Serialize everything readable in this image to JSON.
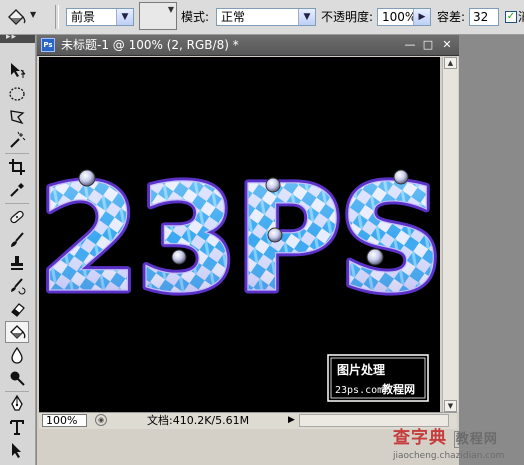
{
  "options_bar": {
    "fill_source_value": "前景",
    "mode_label": "模式:",
    "mode_value": "正常",
    "opacity_label": "不透明度:",
    "opacity_value": "100%",
    "tolerance_label": "容差:",
    "tolerance_value": "32",
    "antialias_label": "消"
  },
  "toolbox": {
    "tools": [
      "move-tool",
      "marquee-tool",
      "lasso-tool",
      "magic-wand-tool",
      "crop-tool",
      "eyedropper-tool",
      "healing-brush-tool",
      "brush-tool",
      "clone-stamp-tool",
      "history-brush-tool",
      "eraser-tool",
      "paint-bucket-tool",
      "blur-tool",
      "dodge-tool",
      "pen-tool",
      "type-tool",
      "path-selection-tool"
    ],
    "active_tool": "paint-bucket-tool"
  },
  "document": {
    "title": "未标题-1 @ 100% (2, RGB/8) *",
    "canvas_text": "23PS",
    "stamp_line1": "图片处理",
    "stamp_line2": "23ps.com",
    "stamp_line3": "教程网",
    "zoom_value": "100%",
    "doc_info": "文档:410.2K/5.61M"
  },
  "site_watermark": {
    "main_text_a": "查字典",
    "main_text_b": "教程网",
    "url": "jiaocheng.chazidian.com"
  },
  "colors": {
    "letter_blue": "#3aa8f0",
    "letter_light": "#e8ecff",
    "letter_edge": "#5a32c8",
    "canvas_bg": "#000000"
  }
}
